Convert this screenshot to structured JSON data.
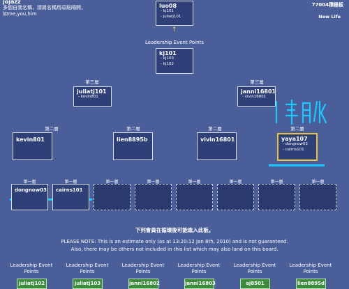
{
  "header": {
    "top_left_title": "jojazz",
    "top_left_line1": "多個自我名稱，請將名稱用逗點隔開，",
    "top_left_line2": "如me,you,him",
    "top_right_title": "77004積極板",
    "top_right_sub": "New Life"
  },
  "colors": {
    "bg": "#4a5e9a",
    "node": "#2f3f78",
    "cyan": "#1ec8ff",
    "green": "#3c8a3c",
    "gold": "#e8c23a"
  },
  "tree": {
    "root": {
      "name": "luo08",
      "subs": [
        "kj101",
        "juliatj101"
      ]
    },
    "arrow": "↑",
    "leadership_label": "Leadership Event Points",
    "second": {
      "name": "kj101",
      "subs": [
        "kj103",
        "kj102"
      ]
    },
    "level3_label": "第三層",
    "level3": [
      {
        "name": "juliatj101",
        "subs": [
          "kevin801"
        ]
      },
      {
        "name": "janni16801",
        "subs": [
          "vivin16801"
        ]
      }
    ],
    "level2_label": "第二層",
    "level2": [
      {
        "name": "kevin801",
        "subs": []
      },
      {
        "name": "lien8895b",
        "subs": []
      },
      {
        "name": "vivin16801",
        "subs": []
      },
      {
        "name": "yaya107",
        "subs": [
          "dongnow03",
          "cairns101"
        ]
      }
    ],
    "level1_label": "第一層",
    "level1": [
      "dongnow03",
      "cairns101",
      "",
      "",
      "",
      "",
      "",
      ""
    ]
  },
  "annotation": {
    "handwritten": "1 年 月 以"
  },
  "notice": {
    "title": "下列會員在循環後可能進入此板。",
    "line1": "PLEASE NOTE: This is an estimate only (as at 13:20:12 Jan 8th, 2010) and is not guaranteed.",
    "line2": "Also, there may be others not included in this list which may also land on this board."
  },
  "bottom": {
    "label": "Leadership Event Points",
    "members": [
      "juliatj102",
      "juliatj103",
      "janni16802",
      "janni16803",
      "aj8501",
      "lien8895d"
    ]
  }
}
